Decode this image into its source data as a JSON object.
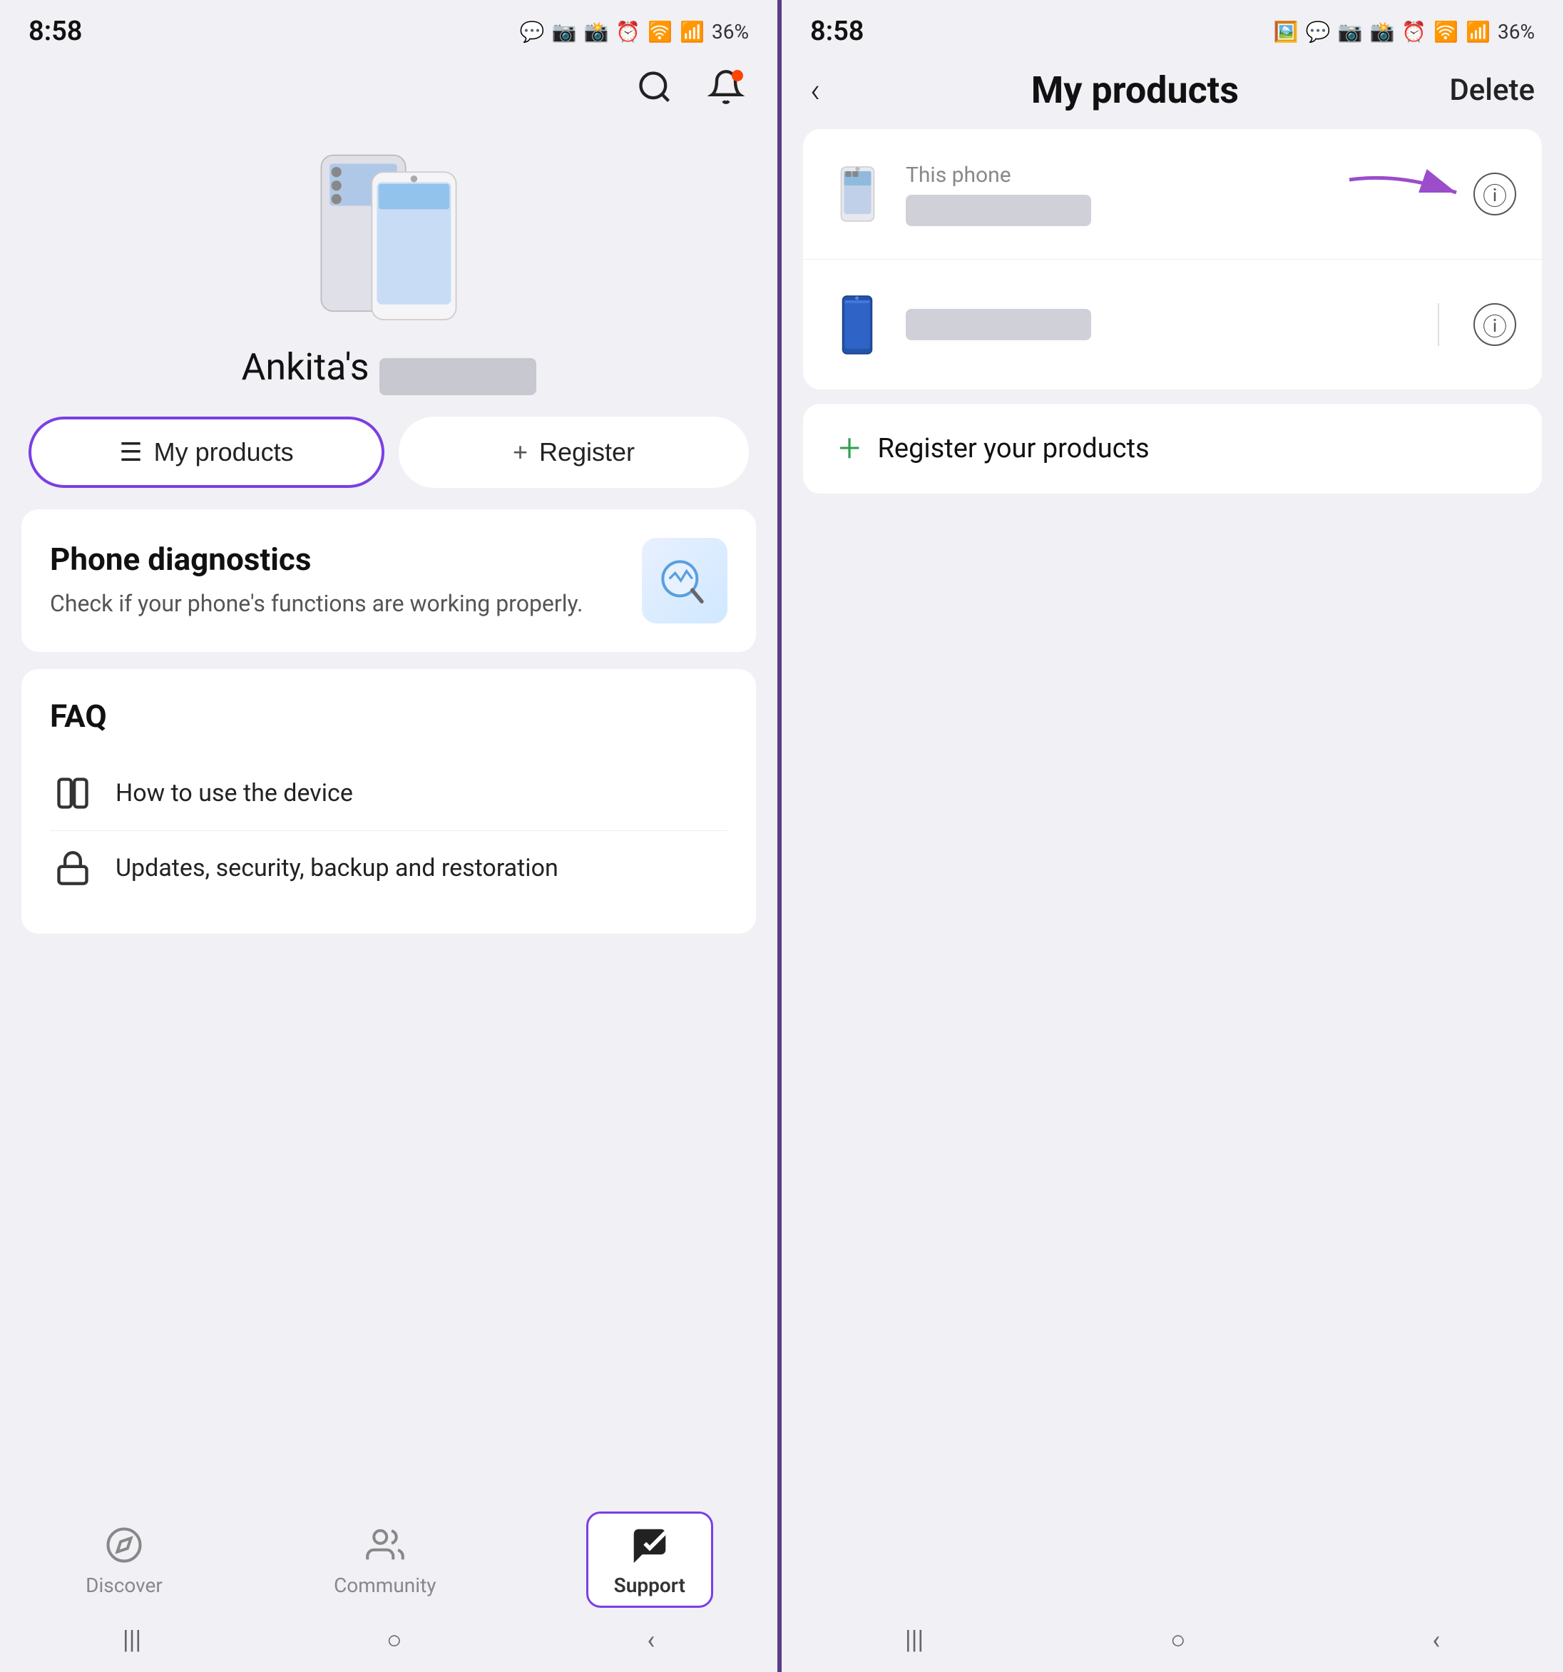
{
  "left_phone": {
    "status_bar": {
      "time": "8:58",
      "battery": "36%"
    },
    "username": "Ankita's",
    "action_buttons": {
      "my_products": "My products",
      "register": "Register"
    },
    "phone_diagnostics": {
      "title": "Phone diagnostics",
      "subtitle": "Check if your phone's functions are working properly."
    },
    "faq": {
      "title": "FAQ",
      "items": [
        "How to use the device",
        "Updates, security, backup and restoration"
      ]
    },
    "bottom_nav": {
      "discover": "Discover",
      "community": "Community",
      "support": "Support"
    }
  },
  "right_phone": {
    "status_bar": {
      "time": "8:58",
      "battery": "36%"
    },
    "header": {
      "title": "My products",
      "delete_label": "Delete",
      "back_label": "back"
    },
    "products": [
      {
        "label": "This phone",
        "name_placeholder": ""
      },
      {
        "label": "",
        "name_placeholder": ""
      }
    ],
    "register_label": "Register your products"
  }
}
